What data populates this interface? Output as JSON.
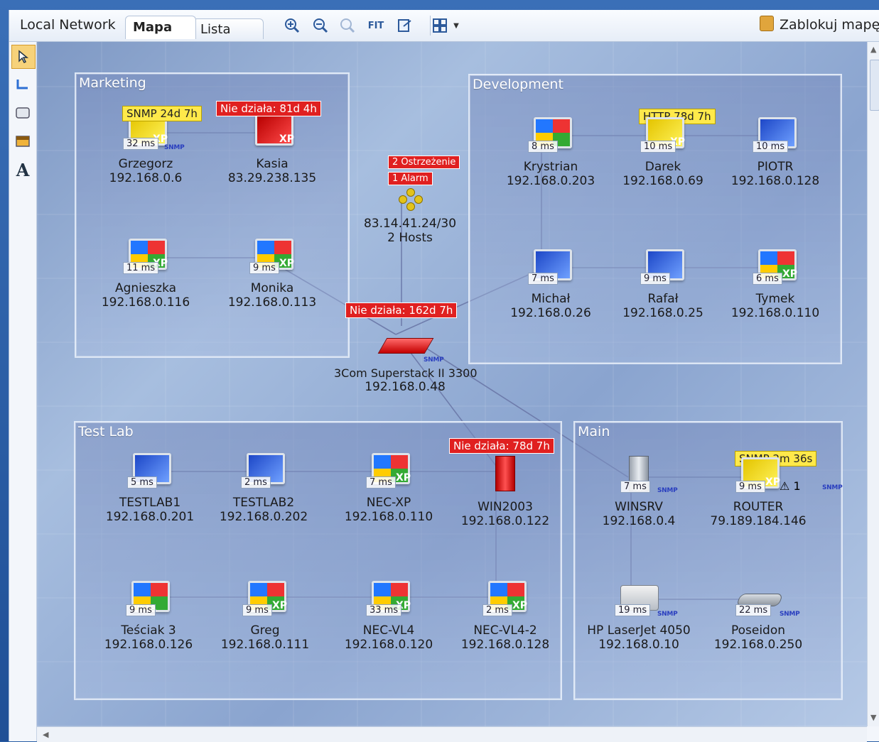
{
  "toolbar": {
    "title": "Local Network",
    "tabs": [
      {
        "label": "Mapa",
        "active": true
      },
      {
        "label": "Lista",
        "active": false
      }
    ],
    "buttons": [
      "zoom-in-icon",
      "zoom-out-icon",
      "zoom-reset-icon",
      "fit-icon",
      "export-icon",
      "layout-grid-icon",
      "dropdown-icon"
    ],
    "fit_label": "FIT",
    "lock_label": "Zablokuj mapę"
  },
  "tools": [
    "pointer-icon",
    "link-tool-icon",
    "rectangle-tool-icon",
    "color-tool-icon",
    "text-tool-icon"
  ],
  "text_tool_glyph": "A",
  "groups": [
    {
      "title": "Marketing"
    },
    {
      "title": "Development"
    },
    {
      "title": "Test Lab"
    },
    {
      "title": "Main"
    }
  ],
  "nodes": {
    "grzegorz": {
      "name": "Grzegorz",
      "ip": "192.168.0.6",
      "ms": "32 ms",
      "badge": "SNMP 24d 7h"
    },
    "kasia": {
      "name": "Kasia",
      "ip": "83.29.238.135",
      "badge": "Nie działa: 81d 4h"
    },
    "agnieszka": {
      "name": "Agnieszka",
      "ip": "192.168.0.116",
      "ms": "11 ms"
    },
    "monika": {
      "name": "Monika",
      "ip": "192.168.0.113",
      "ms": "9 ms"
    },
    "cluster": {
      "name": "83.14.41.24/30",
      "ip": "2 Hosts",
      "badge1": "2 Ostrzeżenie",
      "badge2": "1 Alarm"
    },
    "switch": {
      "name": "3Com Superstack II 3300",
      "ip": "192.168.0.48",
      "badge": "Nie działa: 162d 7h"
    },
    "krystrian": {
      "name": "Krystrian",
      "ip": "192.168.0.203",
      "ms": "8 ms"
    },
    "darek": {
      "name": "Darek",
      "ip": "192.168.0.69",
      "ms": "10 ms",
      "badge": "HTTP 78d 7h"
    },
    "piotr": {
      "name": "PIOTR",
      "ip": "192.168.0.128",
      "ms": "10 ms"
    },
    "michal": {
      "name": "Michał",
      "ip": "192.168.0.26",
      "ms": "7 ms"
    },
    "rafal": {
      "name": "Rafał",
      "ip": "192.168.0.25",
      "ms": "9 ms"
    },
    "tymek": {
      "name": "Tymek",
      "ip": "192.168.0.110",
      "ms": "6 ms"
    },
    "testlab1": {
      "name": "TESTLAB1",
      "ip": "192.168.0.201",
      "ms": "5 ms"
    },
    "testlab2": {
      "name": "TESTLAB2",
      "ip": "192.168.0.202",
      "ms": "2 ms"
    },
    "necxp": {
      "name": "NEC-XP",
      "ip": "192.168.0.110",
      "ms": "7 ms"
    },
    "win2003": {
      "name": "WIN2003",
      "ip": "192.168.0.122",
      "badge": "Nie działa: 78d 7h"
    },
    "tesciak": {
      "name": "Teściak 3",
      "ip": "192.168.0.126",
      "ms": "9 ms"
    },
    "greg": {
      "name": "Greg",
      "ip": "192.168.0.111",
      "ms": "9 ms"
    },
    "necvl4": {
      "name": "NEC-VL4",
      "ip": "192.168.0.120",
      "ms": "33 ms"
    },
    "necvl42": {
      "name": "NEC-VL4-2",
      "ip": "192.168.0.128",
      "ms": "2 ms"
    },
    "winsrv": {
      "name": "WINSRV",
      "ip": "192.168.0.4",
      "ms": "7 ms"
    },
    "router": {
      "name": "ROUTER",
      "ip": "79.189.184.146",
      "ms": "9 ms",
      "badge": "SNMP 2m 36s",
      "warn_count": "1"
    },
    "hplaser": {
      "name": "HP LaserJet 4050",
      "ip": "192.168.0.10",
      "ms": "19 ms"
    },
    "poseidon": {
      "name": "Poseidon",
      "ip": "192.168.0.250",
      "ms": "22 ms"
    }
  },
  "snmp_tag": "SNMP",
  "colors": {
    "alert_red": "#e02020",
    "status_yellow": "#ffe94a",
    "link": "#6b78a8"
  }
}
